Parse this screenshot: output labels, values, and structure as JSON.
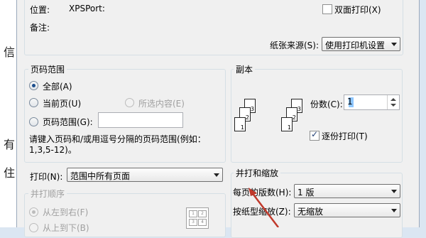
{
  "printer": {
    "location_label": "位置:",
    "location_value": "XPSPort:",
    "comment_label": "备注:",
    "duplex_label": "双面打印(X)",
    "duplex_checked": false,
    "paper_source_label": "纸张来源(S):",
    "paper_source_value": "使用打印机设置"
  },
  "page_range": {
    "title": "页码范围",
    "all_label": "全部(A)",
    "current_label": "当前页(U)",
    "selection_label": "所选内容(E)",
    "pages_label": "页码范围(G):",
    "pages_value": "",
    "hint": "请键入页码和/或用逗号分隔的页码范围(例如：1,3,5-12)。",
    "selected": "all"
  },
  "copies": {
    "title": "副本",
    "count_label": "份数(C):",
    "count_value": "1",
    "collate_label": "逐份打印(T)",
    "collate_checked": true,
    "collate_icon_pages": [
      "3",
      "2",
      "1"
    ]
  },
  "print_what": {
    "label": "打印(N):",
    "value": "范围中所有页面"
  },
  "print_order": {
    "title": "并打顺序",
    "left_right_label": "从左到右(F)",
    "top_bottom_label": "从上到下(B)"
  },
  "zoom": {
    "title": "并打和缩放",
    "pages_per_sheet_label": "每页的版数(H):",
    "pages_per_sheet_value": "1 版",
    "scale_to_paper_label": "按纸型缩放(Z):",
    "scale_to_paper_value": "无缩放"
  },
  "background": {
    "doc_glyphs": [
      "住",
      "有",
      "信"
    ]
  },
  "colors": {
    "accent_arrow": "#c0392b",
    "radio_dot": "#1b4d8c"
  }
}
